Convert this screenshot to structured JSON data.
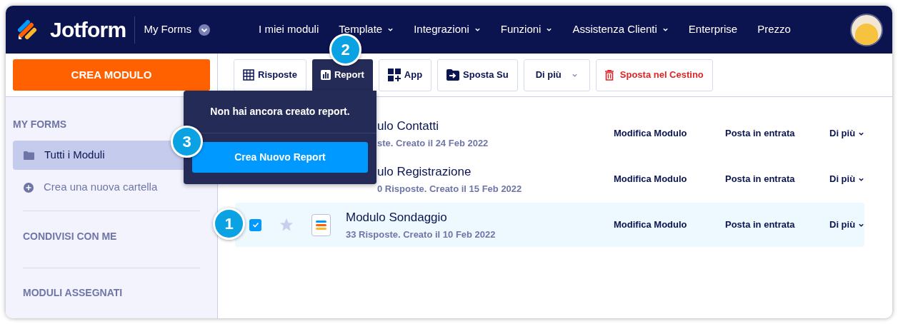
{
  "header": {
    "logo": "Jotform",
    "switcher": "My Forms",
    "nav": [
      {
        "label": "I miei moduli",
        "dropdown": false
      },
      {
        "label": "Template",
        "dropdown": true
      },
      {
        "label": "Integrazioni",
        "dropdown": true
      },
      {
        "label": "Funzioni",
        "dropdown": true
      },
      {
        "label": "Assistenza Clienti",
        "dropdown": true
      },
      {
        "label": "Enterprise",
        "dropdown": false
      },
      {
        "label": "Prezzo",
        "dropdown": false
      }
    ]
  },
  "sidebar": {
    "create_button": "CREA MODULO",
    "section": "MY FORMS",
    "items": [
      {
        "kind": "folder",
        "label": "Tutti i Moduli",
        "selected": true
      },
      {
        "kind": "add",
        "label": "Crea una nuova cartella",
        "selected": false
      }
    ],
    "groups": [
      "CONDIVISI CON ME",
      "MODULI ASSEGNATI"
    ]
  },
  "toolbar": [
    {
      "kind": "table",
      "label": "Risposte",
      "selected": false
    },
    {
      "kind": "report",
      "label": "Report",
      "selected": true
    },
    {
      "kind": "app",
      "label": "App",
      "selected": false
    },
    {
      "kind": "move",
      "label": "Sposta Su",
      "selected": false
    },
    {
      "kind": "more",
      "label": "Di più",
      "selected": false
    },
    {
      "kind": "trash",
      "label": "Sposta nel Cestino",
      "selected": false
    }
  ],
  "popover": {
    "message": "Non hai ancora creato report.",
    "button": "Crea Nuovo Report"
  },
  "forms": [
    {
      "title": "ulo Contatti",
      "meta": "ste. Creato il 24 Feb 2022",
      "covered": true,
      "selected": false,
      "actions": [
        "Modifica Modulo",
        "Posta in entrata",
        "Di più"
      ]
    },
    {
      "title": "ulo Registrazione",
      "meta": "0 Risposte. Creato il 15 Feb 2022",
      "covered": true,
      "selected": false,
      "actions": [
        "Modifica Modulo",
        "Posta in entrata",
        "Di più"
      ]
    },
    {
      "title": "Modulo Sondaggio",
      "meta": "33 Risposte. Creato il 10 Feb 2022",
      "covered": false,
      "checked": true,
      "starred": false,
      "selected": true,
      "actions": [
        "Modifica Modulo",
        "Posta in entrata",
        "Di più"
      ]
    }
  ],
  "callouts": [
    "1",
    "2",
    "3"
  ]
}
